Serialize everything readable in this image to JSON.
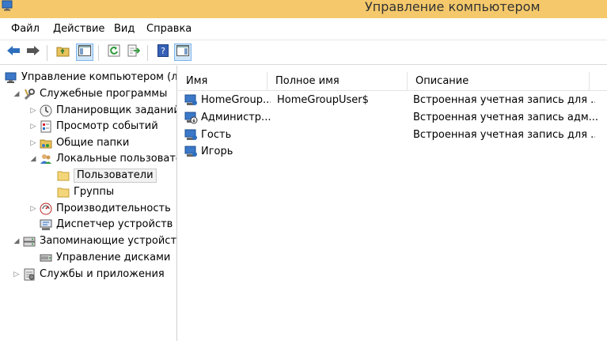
{
  "window": {
    "title": "Управление компьютером"
  },
  "menu": {
    "file": "Файл",
    "action": "Действие",
    "view": "Вид",
    "help": "Справка"
  },
  "toolbar": {
    "buttons": [
      "back-arrow-icon",
      "forward-arrow-icon",
      "up-folder-icon",
      "show-hide-tree-icon",
      "refresh-icon",
      "export-list-icon",
      "help-icon",
      "show-hide-action-pane-icon"
    ]
  },
  "tree": {
    "root": "Управление компьютером (л",
    "system_tools": "Служебные программы",
    "task_scheduler": "Планировщик заданий",
    "event_viewer": "Просмотр событий",
    "shared_folders": "Общие папки",
    "local_users": "Локальные пользовате",
    "users": "Пользователи",
    "groups": "Группы",
    "performance": "Производительность",
    "device_manager": "Диспетчер устройств",
    "storage": "Запоминающие устройст",
    "disk_management": "Управление дисками",
    "services": "Службы и приложения"
  },
  "list": {
    "columns": {
      "name": "Имя",
      "full_name": "Полное имя",
      "description": "Описание"
    },
    "rows": [
      {
        "name": "HomeGroup...",
        "full_name": "HomeGroupUser$",
        "description": "Встроенная учетная запись для ..."
      },
      {
        "name": "Администр...",
        "full_name": "",
        "description": "Встроенная учетная запись адм..."
      },
      {
        "name": "Гость",
        "full_name": "",
        "description": "Встроенная учетная запись для ..."
      },
      {
        "name": "Игорь",
        "full_name": "",
        "description": ""
      }
    ]
  },
  "colors": {
    "titlebar": "#f5c96b",
    "selection": "#cfe6f9",
    "accent": "#2e6fbd"
  }
}
